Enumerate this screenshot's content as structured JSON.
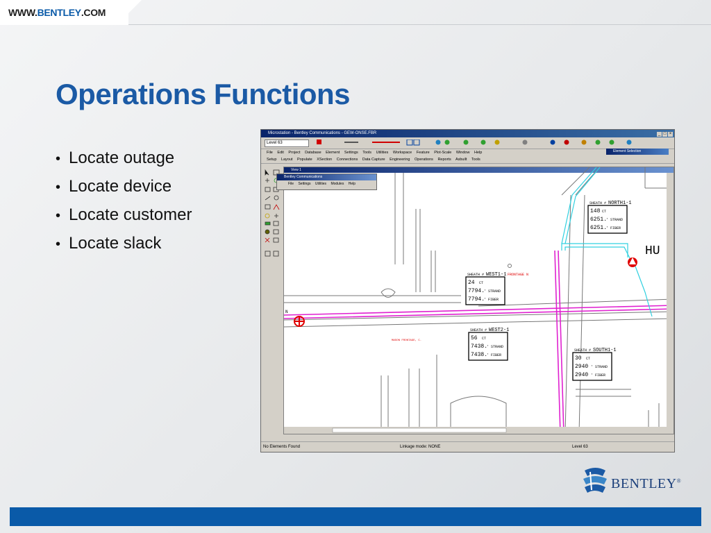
{
  "header": {
    "url_prefix": "WWW.",
    "url_brand": "BENTLEY",
    "url_suffix": ".COM"
  },
  "title": "Operations Functions",
  "bullets": [
    "Locate outage",
    "Locate device",
    "Locate customer",
    "Locate slack"
  ],
  "screenshot": {
    "window_title": "Microstation - Bentley Communications - GEW-ONSE.FBR",
    "level_select": "Level 63",
    "menu1": [
      "File",
      "Edit",
      "Project",
      "Database",
      "Element",
      "Settings",
      "Tools",
      "Utilities",
      "Workspace",
      "Feature",
      "Plot-Scale",
      "Window",
      "Help"
    ],
    "menu2": [
      "Setup",
      "Layout",
      "Populate",
      "XSection",
      "Connections",
      "Data Capture",
      "Engineering",
      "Operations",
      "Reports",
      "Asbuilt",
      "Tools"
    ],
    "element_selection": "Element Selection",
    "view_title": "View 1",
    "popup_title": "Bentley Communications",
    "popup_menu": [
      "File",
      "Settings",
      "Utilities",
      "Modules",
      "Help"
    ],
    "status_left": "No Elements Found",
    "status_mid": "Linkage mode: NONE",
    "status_right": "Level 63",
    "map": {
      "hu_label": "HU",
      "n_label": "N",
      "north": {
        "sheath": "SHEATH #",
        "name": "NORTH1-1",
        "r1": "148",
        "r1u": "CT",
        "r2": "6251.",
        "r2u": "' STRAND",
        "r3": "6251.",
        "r3u": "' FIBER"
      },
      "west1": {
        "sheath": "SHEATH #",
        "name": "WEST1-1",
        "r1": "24",
        "r1u": "CT",
        "r2": "7794.",
        "r2u": "' STRAND",
        "r3": "7794.",
        "r3u": "' FIBER",
        "road": "FRONTAGE N"
      },
      "west2": {
        "sheath": "SHEATH #",
        "name": "WEST2-1",
        "r1": "56",
        "r1u": "CT",
        "r2": "7438.",
        "r2u": "' STRAND",
        "r3": "7438.",
        "r3u": "' FIBER"
      },
      "south": {
        "sheath": "SHEATH #",
        "name": "SOUTH1-1",
        "r1": "30",
        "r1u": "CT",
        "r2": "2940",
        "r2u": "' STRAND",
        "r3": "2940",
        "r3u": "' FIBER"
      },
      "road_mason": "MASON FRONTAGE, C."
    }
  },
  "logo": {
    "text": "BENTLEY",
    "mark": "®"
  },
  "colors": {
    "title": "#1b5aa5",
    "footer": "#0a5aa8",
    "fiber_pink": "#e020d0",
    "fiber_cyan": "#30d0e0",
    "outage_red": "#e00000"
  }
}
